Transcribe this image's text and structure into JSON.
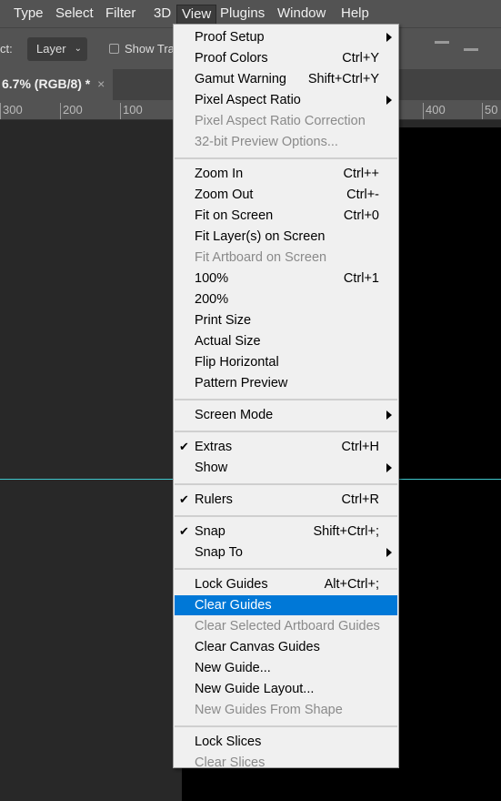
{
  "menubar": [
    "Type",
    "Select",
    "Filter",
    "3D",
    "View",
    "Plugins",
    "Window",
    "Help"
  ],
  "options": {
    "label": "ct:",
    "layer_select": "Layer",
    "show_transform": "Show Tra"
  },
  "tab": {
    "title": "6.7% (RGB/8) *",
    "close": "×"
  },
  "ruler": [
    "300",
    "200",
    "100",
    "400",
    "50"
  ],
  "colors": {
    "highlight": "#0078d7",
    "guide": "#3fc7cc"
  },
  "menu": [
    {
      "label": "Proof Setup",
      "submenu": true
    },
    {
      "label": "Proof Colors",
      "shortcut": "Ctrl+Y"
    },
    {
      "label": "Gamut Warning",
      "shortcut": "Shift+Ctrl+Y"
    },
    {
      "label": "Pixel Aspect Ratio",
      "submenu": true
    },
    {
      "label": "Pixel Aspect Ratio Correction",
      "disabled": true
    },
    {
      "label": "32-bit Preview Options...",
      "disabled": true
    },
    {
      "sep": true
    },
    {
      "label": "Zoom In",
      "shortcut": "Ctrl++"
    },
    {
      "label": "Zoom Out",
      "shortcut": "Ctrl+-"
    },
    {
      "label": "Fit on Screen",
      "shortcut": "Ctrl+0"
    },
    {
      "label": "Fit Layer(s) on Screen"
    },
    {
      "label": "Fit Artboard on Screen",
      "disabled": true
    },
    {
      "label": "100%",
      "shortcut": "Ctrl+1"
    },
    {
      "label": "200%"
    },
    {
      "label": "Print Size"
    },
    {
      "label": "Actual Size"
    },
    {
      "label": "Flip Horizontal"
    },
    {
      "label": "Pattern Preview"
    },
    {
      "sep": true
    },
    {
      "label": "Screen Mode",
      "submenu": true
    },
    {
      "sep": true
    },
    {
      "label": "Extras",
      "shortcut": "Ctrl+H",
      "checked": true
    },
    {
      "label": "Show",
      "submenu": true
    },
    {
      "sep": true
    },
    {
      "label": "Rulers",
      "shortcut": "Ctrl+R",
      "checked": true
    },
    {
      "sep": true
    },
    {
      "label": "Snap",
      "shortcut": "Shift+Ctrl+;",
      "checked": true
    },
    {
      "label": "Snap To",
      "submenu": true
    },
    {
      "sep": true
    },
    {
      "label": "Lock Guides",
      "shortcut": "Alt+Ctrl+;"
    },
    {
      "label": "Clear Guides",
      "highlighted": true
    },
    {
      "label": "Clear Selected Artboard Guides",
      "disabled": true
    },
    {
      "label": "Clear Canvas Guides"
    },
    {
      "label": "New Guide..."
    },
    {
      "label": "New Guide Layout..."
    },
    {
      "label": "New Guides From Shape",
      "disabled": true
    },
    {
      "sep": true
    },
    {
      "label": "Lock Slices"
    },
    {
      "label": "Clear Slices",
      "disabled": true
    }
  ]
}
